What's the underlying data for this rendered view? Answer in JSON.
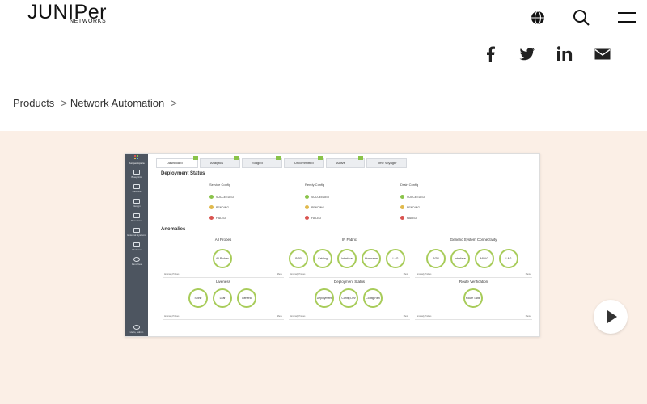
{
  "header": {
    "logo_main": "JUNIPer",
    "logo_sub": "NETWORKS",
    "icons": [
      "globe-icon",
      "search-icon",
      "menu-icon"
    ]
  },
  "social": [
    "facebook-icon",
    "twitter-icon",
    "linkedin-icon",
    "email-icon"
  ],
  "breadcrumb": {
    "items": [
      "Products",
      "Network Automation"
    ],
    "separator": ">"
  },
  "video": {
    "sidebar": {
      "brand": "Juniper Apstra",
      "items": [
        "Blueprints",
        "Devices",
        "Design",
        "Resources",
        "External Systems",
        "Platform",
        "Favorites"
      ],
      "user": "Hello, admin"
    },
    "tabs": [
      "Dashboard",
      "Analytics",
      "Staged",
      "Uncommitted",
      "Active",
      "Time Voyager"
    ],
    "deployment_title": "Deployment Status",
    "configs": [
      {
        "title": "Service Config",
        "rows": [
          "SUCCEEDED",
          "PENDING",
          "FAILED"
        ]
      },
      {
        "title": "Rendy Config",
        "rows": [
          "SUCCEEDED",
          "PENDING",
          "FAILED"
        ]
      },
      {
        "title": "Drain Config",
        "rows": [
          "SUCCEEDED",
          "PENDING",
          "FAILED"
        ]
      }
    ],
    "anomalies_title": "Anomalies",
    "panels": [
      {
        "title": "All Probes",
        "rings": [
          "All Probes"
        ]
      },
      {
        "title": "IP Fabric",
        "rings": [
          "BGP",
          "Cabling",
          "Interface",
          "Hostname",
          "LAG"
        ]
      },
      {
        "title": "Generic System Connectivity",
        "rings": [
          "BGP",
          "Interface",
          "MLAG",
          "LAG"
        ]
      },
      {
        "title": "Liveness",
        "rings": [
          "Spine",
          "Leaf",
          "Generic"
        ]
      },
      {
        "title": "Deployment Status",
        "rings": [
          "Deployment",
          "Config Dev",
          "Config Ren"
        ]
      },
      {
        "title": "Route Verification",
        "rings": [
          "Route Table"
        ]
      }
    ],
    "panel_foot_left": "Anomaly Probes",
    "panel_foot_right": "Menu",
    "colors": {
      "ring": "#a8cc5a",
      "sidebar": "#4d5560",
      "success": "#8ac34a",
      "pending": "#e0b94c",
      "failed": "#d9534f"
    }
  },
  "play_button": "play-icon",
  "colors": {
    "band": "#fbefe6"
  }
}
